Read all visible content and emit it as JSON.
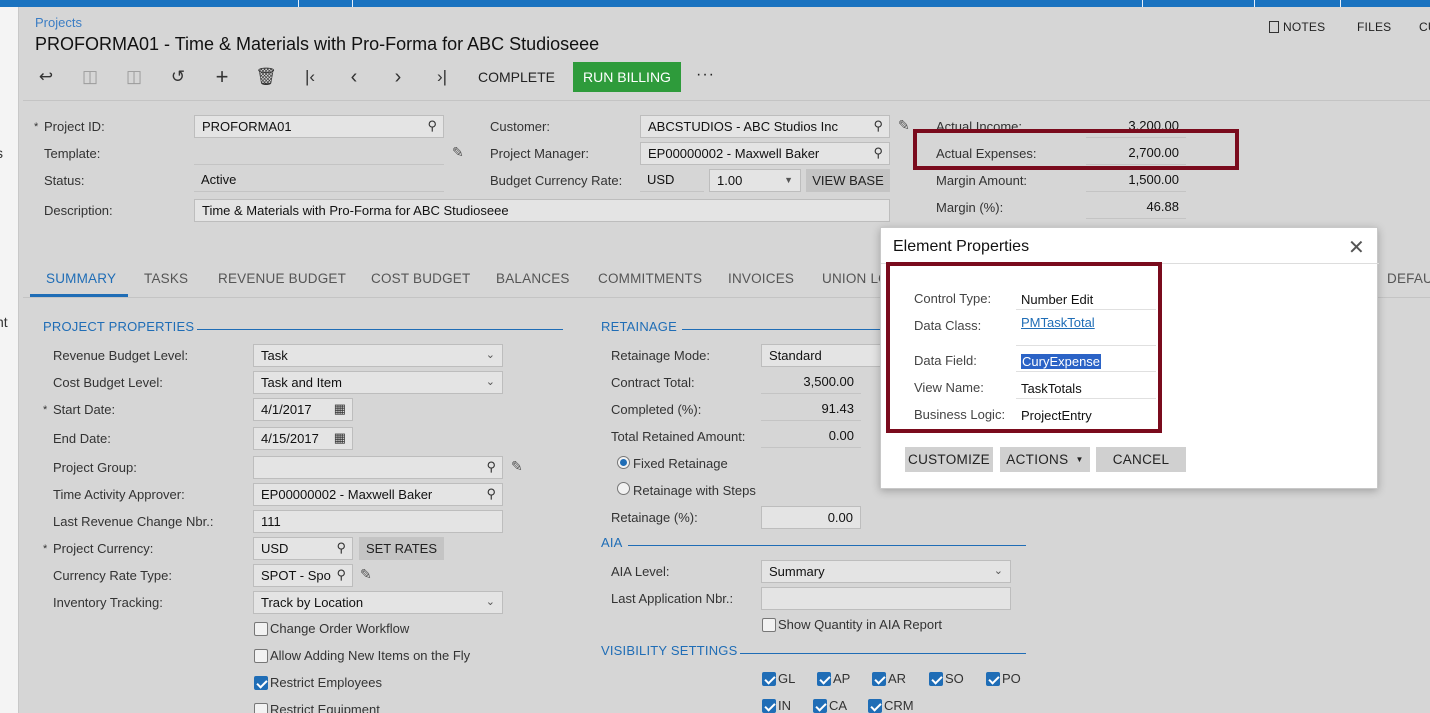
{
  "app": {
    "breadcrumb": "Projects",
    "title": "PROFORMA01 - Time & Materials with Pro-Forma for ABC Studioseee",
    "top_tools": {
      "notes": "NOTES",
      "files": "FILES",
      "more": "CU"
    },
    "left_strip": {
      "text1": "s",
      "text2": "nt"
    }
  },
  "toolbar": {
    "icons": [
      "back-icon",
      "save-close-icon",
      "save-icon",
      "undo-icon",
      "add-icon",
      "delete-icon",
      "first-icon",
      "previous-icon",
      "next-icon",
      "last-icon"
    ],
    "complete_label": "COMPLETE",
    "run_billing_label": "RUN BILLING",
    "more_label": "···"
  },
  "header": {
    "project_id_label": "Project ID:",
    "project_id": "PROFORMA01",
    "template_label": "Template:",
    "template": "",
    "status_label": "Status:",
    "status": "Active",
    "description_label": "Description:",
    "description": "Time & Materials with Pro-Forma for ABC Studioseee",
    "customer_label": "Customer:",
    "customer": "ABCSTUDIOS - ABC Studios Inc",
    "project_manager_label": "Project Manager:",
    "project_manager": "EP00000002 - Maxwell Baker",
    "budget_currency_rate_label": "Budget Currency Rate:",
    "budget_currency": "USD",
    "budget_rate": "1.00",
    "view_base_label": "VIEW BASE",
    "actual_income_label": "Actual Income:",
    "actual_income": "3,200.00",
    "actual_expenses_label": "Actual Expenses:",
    "actual_expenses": "2,700.00",
    "margin_amount_label": "Margin Amount:",
    "margin_amount": "1,500.00",
    "margin_pct_label": "Margin (%):",
    "margin_pct": "46.88"
  },
  "tabs": [
    "SUMMARY",
    "TASKS",
    "REVENUE BUDGET",
    "COST BUDGET",
    "BALANCES",
    "COMMITMENTS",
    "INVOICES",
    "UNION LO",
    "DEFAU"
  ],
  "project_properties": {
    "section_title": "PROJECT PROPERTIES",
    "revenue_budget_level_label": "Revenue Budget Level:",
    "revenue_budget_level": "Task",
    "cost_budget_level_label": "Cost Budget Level:",
    "cost_budget_level": "Task and Item",
    "start_date_label": "Start Date:",
    "start_date": "4/1/2017",
    "end_date_label": "End Date:",
    "end_date": "4/15/2017",
    "project_group_label": "Project Group:",
    "project_group": "",
    "time_activity_approver_label": "Time Activity Approver:",
    "time_activity_approver": "EP00000002 - Maxwell Baker",
    "last_revenue_change_label": "Last Revenue Change Nbr.:",
    "last_revenue_change": "111",
    "project_currency_label": "Project Currency:",
    "project_currency": "USD",
    "set_rates_label": "SET RATES",
    "currency_rate_type_label": "Currency Rate Type:",
    "currency_rate_type": "SPOT - Spo",
    "inventory_tracking_label": "Inventory Tracking:",
    "inventory_tracking": "Track by Location",
    "change_order_workflow_label": "Change Order Workflow",
    "change_order_workflow": false,
    "allow_adding_items_label": "Allow Adding New Items on the Fly",
    "allow_adding_items": false,
    "restrict_employees_label": "Restrict Employees",
    "restrict_employees": true,
    "restrict_equipment_label": "Restrict Equipment",
    "restrict_equipment": false
  },
  "retainage": {
    "section_title": "RETAINAGE",
    "mode_label": "Retainage Mode:",
    "mode": "Standard",
    "contract_total_label": "Contract Total:",
    "contract_total": "3,500.00",
    "completed_label": "Completed (%):",
    "completed": "91.43",
    "total_retained_label": "Total Retained Amount:",
    "total_retained": "0.00",
    "fixed_retainage_label": "Fixed Retainage",
    "retainage_with_steps_label": "Retainage with Steps",
    "retainage_pct_label": "Retainage (%):",
    "retainage_pct": "0.00"
  },
  "aia": {
    "section_title": "AIA",
    "level_label": "AIA Level:",
    "level": "Summary",
    "last_application_label": "Last Application Nbr.:",
    "last_application": "",
    "show_quantity_label": "Show Quantity in AIA Report",
    "show_quantity": false
  },
  "visibility": {
    "section_title": "VISIBILITY SETTINGS",
    "items": [
      {
        "label": "GL",
        "checked": true
      },
      {
        "label": "AP",
        "checked": true
      },
      {
        "label": "AR",
        "checked": true
      },
      {
        "label": "SO",
        "checked": true
      },
      {
        "label": "PO",
        "checked": true
      },
      {
        "label": "IN",
        "checked": true
      },
      {
        "label": "CA",
        "checked": true
      },
      {
        "label": "CRM",
        "checked": true
      }
    ]
  },
  "dialog": {
    "title": "Element Properties",
    "control_type_label": "Control Type:",
    "control_type": "Number Edit",
    "data_class_label": "Data Class:",
    "data_class": "PMTaskTotal",
    "data_field_label": "Data Field:",
    "data_field": "CuryExpense",
    "view_name_label": "View Name:",
    "view_name": "TaskTotals",
    "business_logic_label": "Business Logic:",
    "business_logic": "ProjectEntry",
    "customize_label": "CUSTOMIZE",
    "actions_label": "ACTIONS",
    "cancel_label": "CANCEL"
  },
  "colors": {
    "accent": "#1f6db6",
    "run_billing": "#2e9b3b",
    "highlight_box": "#7a0b1d"
  }
}
